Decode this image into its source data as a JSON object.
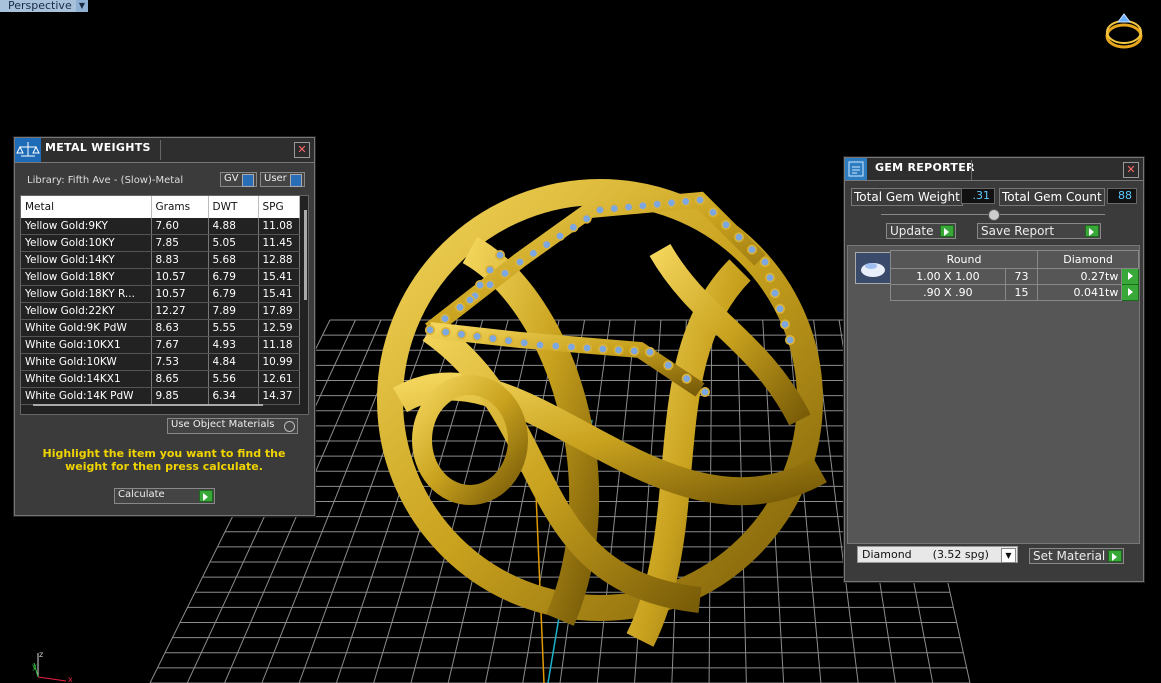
{
  "viewport": {
    "view_label": "Perspective",
    "axis_labels": {
      "x": "x",
      "y": "y",
      "z": "z"
    }
  },
  "metal_weights": {
    "title": "METAL WEIGHTS",
    "library": "Library: Fifth Ave - (Slow)-Metal",
    "gv_label": "GV",
    "user_label": "User",
    "columns": [
      "Metal",
      "Grams",
      "DWT",
      "SPG"
    ],
    "rows": [
      [
        "Yellow Gold:9KY",
        "7.60",
        "4.88",
        "11.08"
      ],
      [
        "Yellow Gold:10KY",
        "7.85",
        "5.05",
        "11.45"
      ],
      [
        "Yellow Gold:14KY",
        "8.83",
        "5.68",
        "12.88"
      ],
      [
        "Yellow Gold:18KY",
        "10.57",
        "6.79",
        "15.41"
      ],
      [
        "Yellow Gold:18KY R...",
        "10.57",
        "6.79",
        "15.41"
      ],
      [
        "Yellow Gold:22KY",
        "12.27",
        "7.89",
        "17.89"
      ],
      [
        "White Gold:9K PdW",
        "8.63",
        "5.55",
        "12.59"
      ],
      [
        "White Gold:10KX1",
        "7.67",
        "4.93",
        "11.18"
      ],
      [
        "White Gold:10KW",
        "7.53",
        "4.84",
        "10.99"
      ],
      [
        "White Gold:14KX1",
        "8.65",
        "5.56",
        "12.61"
      ],
      [
        "White Gold:14K PdW",
        "9.85",
        "6.34",
        "14.37"
      ]
    ],
    "use_object_materials": "Use Object Materials",
    "instruction": "Highlight the item you want to find the weight for then press calculate.",
    "calculate_label": "Calculate"
  },
  "gem_reporter": {
    "title": "GEM REPORTER",
    "total_gem_weight_label": "Total Gem Weight",
    "total_gem_weight": ".31",
    "total_gem_count_label": "Total Gem Count",
    "total_gem_count": "88",
    "update_label": "Update",
    "save_report_label": "Save Report",
    "table_headers": [
      "Round",
      "Diamond"
    ],
    "rows": [
      [
        "1.00 X 1.00",
        "73",
        "0.27tw"
      ],
      [
        ".90 X .90",
        "15",
        "0.041tw"
      ]
    ],
    "material_select": "Diamond      (3.52 spg)",
    "set_material_label": "Set Material"
  },
  "colors": {
    "gold": "#c9a21e",
    "gem_blue": "#7da7e0",
    "go_green": "#38a838",
    "field_blue": "#5ec8ff",
    "instruction_yellow": "#f0d400"
  }
}
